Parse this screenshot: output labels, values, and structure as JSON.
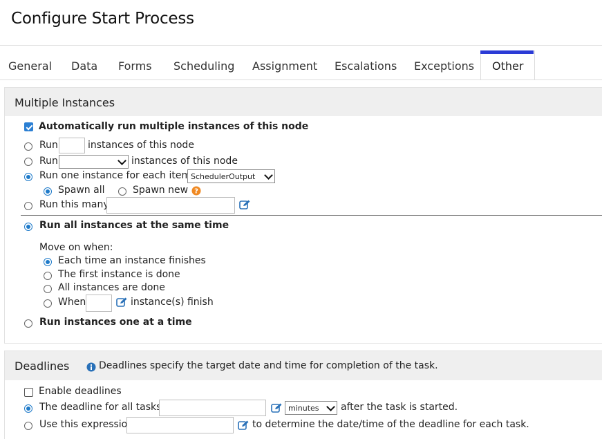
{
  "page": {
    "title": "Configure Start Process"
  },
  "tabs": [
    {
      "label": "General"
    },
    {
      "label": "Data"
    },
    {
      "label": "Forms"
    },
    {
      "label": "Scheduling"
    },
    {
      "label": "Assignment"
    },
    {
      "label": "Escalations"
    },
    {
      "label": "Exceptions"
    },
    {
      "label": "Other",
      "active": true
    }
  ],
  "multiple": {
    "title": "Multiple Instances",
    "auto_label": "Automatically run multiple instances of this node",
    "auto_checked": true,
    "run_word": "Run",
    "instances_of_node": "instances of this node",
    "run_each_prefix": "Run one instance for each item in",
    "each_select_value": "SchedulerOutput",
    "spawn_all": "Spawn all",
    "spawn_new": "Spawn new",
    "run_this_many": "Run this many:",
    "run_all_same_time": "Run all instances at the same time",
    "move_on_when": "Move on when:",
    "move_options": [
      {
        "label": "Each time an instance finishes"
      },
      {
        "label": "The first instance is done"
      },
      {
        "label": "All instances are done"
      }
    ],
    "when_word": "When",
    "instances_finish": "instance(s) finish",
    "run_one_at_a_time": "Run instances one at a time"
  },
  "deadlines": {
    "title": "Deadlines",
    "info": "Deadlines specify the target date and time for completion of the task.",
    "enable_label": "Enable deadlines",
    "enable_checked": false,
    "all_tasks_prefix": "The deadline for all tasks is",
    "unit_value": "minutes",
    "after_started": "after the task is started.",
    "use_expression": "Use this expression",
    "expr_suffix": "to determine the date/time of the deadline for each task."
  },
  "colors": {
    "accent": "#2b3bd6",
    "radio": "#1e7ac9",
    "check": "#2b7fd3",
    "help": "#f08a24",
    "info": "#2870b8"
  },
  "icons": [
    "edit-icon",
    "help-icon",
    "info-icon",
    "chevron-down-icon"
  ]
}
